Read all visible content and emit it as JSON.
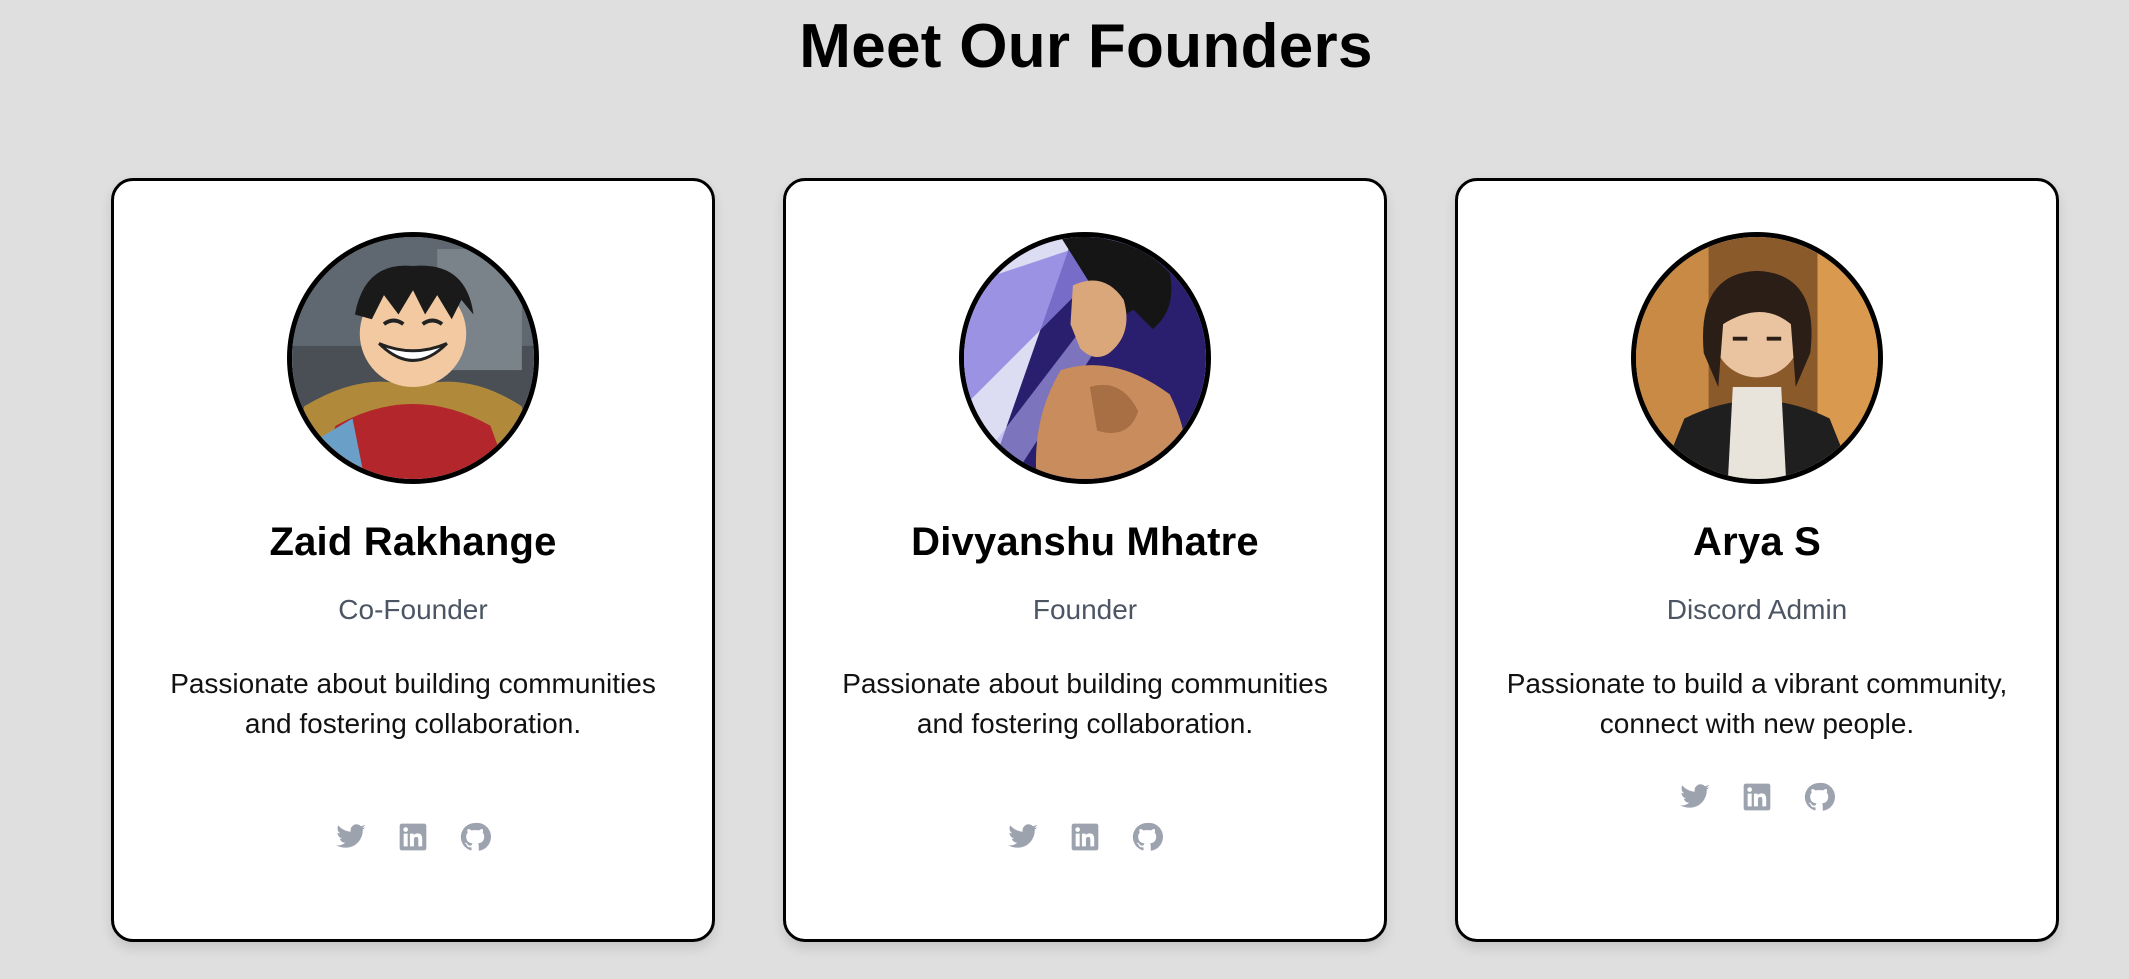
{
  "page": {
    "title": "Meet Our Founders"
  },
  "founders": [
    {
      "name": "Zaid Rakhange",
      "role": "Co-Founder",
      "bio": "Passionate about building communities and fostering collaboration.",
      "avatar_icon": "avatar-anime-straw-hat",
      "socials": [
        "twitter-icon",
        "linkedin-icon",
        "github-icon"
      ]
    },
    {
      "name": "Divyanshu Mhatre",
      "role": "Founder",
      "bio": "Passionate about building communities and fostering collaboration.",
      "avatar_icon": "avatar-anime-warrior",
      "socials": [
        "twitter-icon",
        "linkedin-icon",
        "github-icon"
      ]
    },
    {
      "name": "Arya S",
      "role": "Discord Admin",
      "bio": "Passionate to build a vibrant community, connect with new people.",
      "avatar_icon": "avatar-anime-dark-hair",
      "socials": [
        "twitter-icon",
        "linkedin-icon",
        "github-icon"
      ]
    }
  ],
  "colors": {
    "background": "#e0dfe0",
    "card": "#ffffff",
    "border": "#000000",
    "role_text": "#4b5563",
    "icon": "#9ca3af"
  }
}
